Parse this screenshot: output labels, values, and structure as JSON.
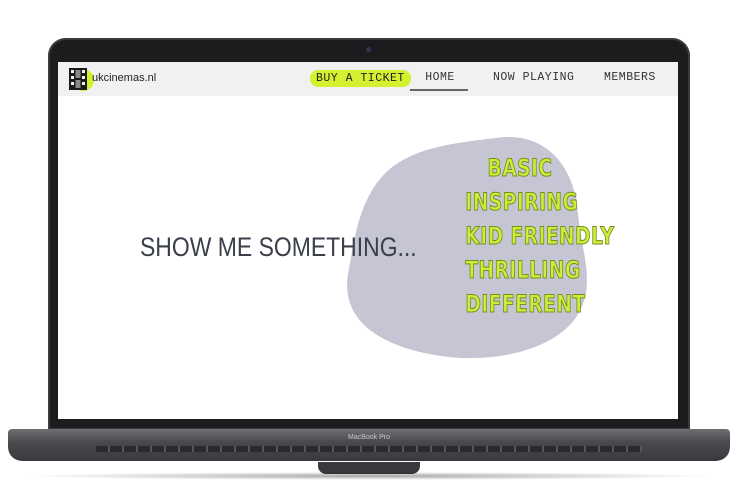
{
  "site": {
    "logo_text": "ukcinemas.nl"
  },
  "nav": {
    "buy_label": "BUY A TICKET",
    "home_label": "HOME",
    "now_playing_label": "NOW PLAYING",
    "members_label": "MEMBERS"
  },
  "hero": {
    "title": "SHOW ME SOMETHING...",
    "options": [
      "BASIC",
      "INSPIRING",
      "KID FRIENDLY",
      "THRILLING",
      "DIFFERENT"
    ]
  },
  "device": {
    "label": "MacBook Pro"
  },
  "colors": {
    "accent": "#d4f02e",
    "blob": "#c5c5d3",
    "text": "#3a3f4a"
  },
  "icons": {
    "logo": "film-strip-icon"
  }
}
